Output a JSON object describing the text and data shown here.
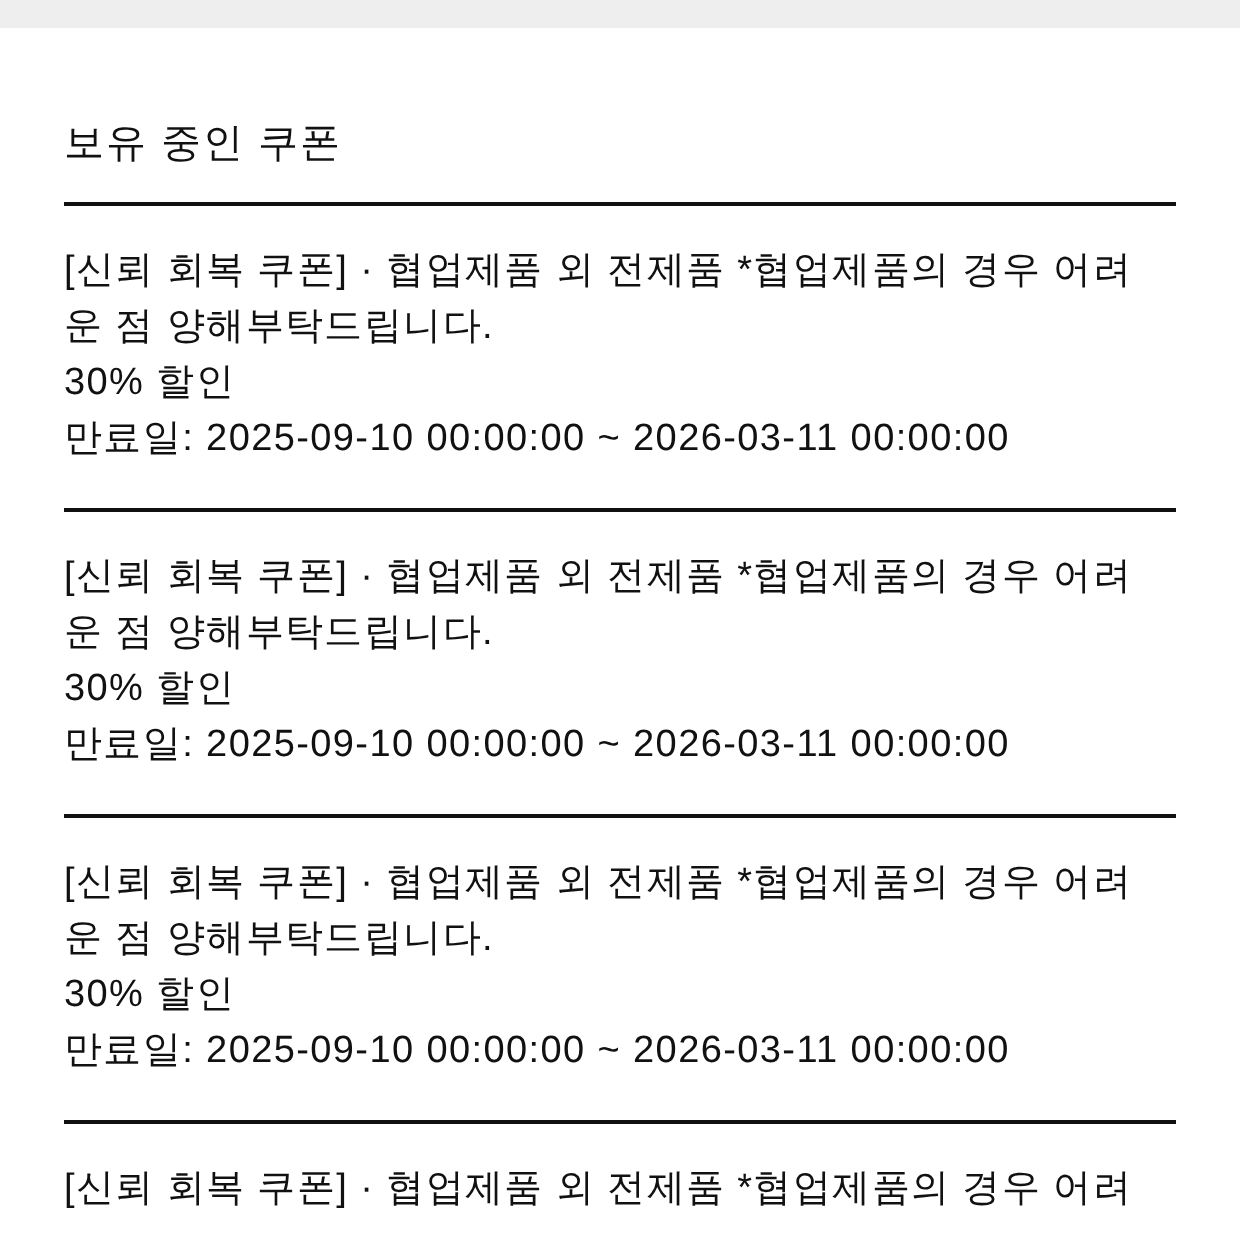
{
  "section_title": "보유 중인 쿠폰",
  "coupons": [
    {
      "description": "[신뢰 회복 쿠폰] · 협업제품 외 전제품 *협업제품의 경우 어려운 점 양해부탁드립니다.",
      "discount": "30% 할인",
      "expiry": "만료일: 2025-09-10 00:00:00 ~ 2026-03-11 00:00:00"
    },
    {
      "description": "[신뢰 회복 쿠폰] · 협업제품 외 전제품 *협업제품의 경우 어려운 점 양해부탁드립니다.",
      "discount": "30% 할인",
      "expiry": "만료일: 2025-09-10 00:00:00 ~ 2026-03-11 00:00:00"
    },
    {
      "description": "[신뢰 회복 쿠폰] · 협업제품 외 전제품 *협업제품의 경우 어려운 점 양해부탁드립니다.",
      "discount": "30% 할인",
      "expiry": "만료일: 2025-09-10 00:00:00 ~ 2026-03-11 00:00:00"
    },
    {
      "description": "[신뢰 회복 쿠폰] · 협업제품 외 전제품 *협업제품의 경우 어려"
    }
  ]
}
